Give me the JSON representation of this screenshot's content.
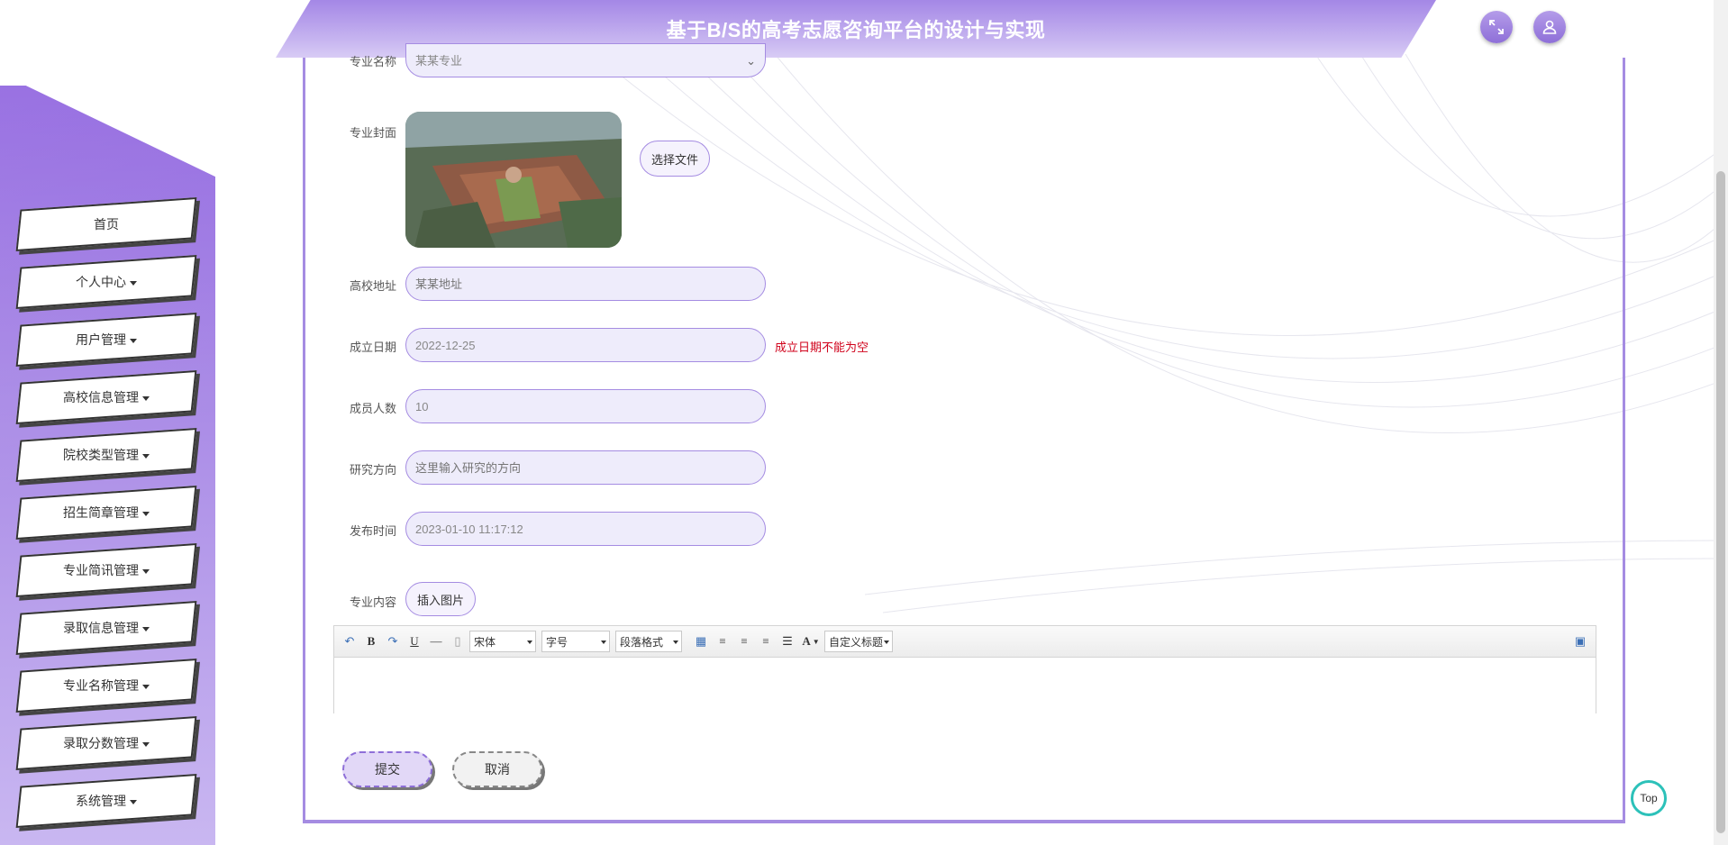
{
  "header": {
    "title": "基于B/S的高考志愿咨询平台的设计与实现",
    "fullscreen_icon": "expand-icon",
    "user_icon": "user-icon"
  },
  "sidebar": {
    "items": [
      {
        "label": "首页",
        "has_caret": false
      },
      {
        "label": "个人中心",
        "has_caret": true
      },
      {
        "label": "用户管理",
        "has_caret": true
      },
      {
        "label": "高校信息管理",
        "has_caret": true
      },
      {
        "label": "院校类型管理",
        "has_caret": true
      },
      {
        "label": "招生简章管理",
        "has_caret": true
      },
      {
        "label": "专业简讯管理",
        "has_caret": true
      },
      {
        "label": "录取信息管理",
        "has_caret": true
      },
      {
        "label": "专业名称管理",
        "has_caret": true
      },
      {
        "label": "录取分数管理",
        "has_caret": true
      },
      {
        "label": "系统管理",
        "has_caret": true
      }
    ]
  },
  "form": {
    "major_name": {
      "label": "专业名称",
      "value": "某某专业"
    },
    "cover": {
      "label": "专业封面",
      "button": "选择文件"
    },
    "address": {
      "label": "高校地址",
      "placeholder": "某某地址"
    },
    "founded": {
      "label": "成立日期",
      "value": "2022-12-25",
      "error": "成立日期不能为空"
    },
    "members": {
      "label": "成员人数",
      "value": "10"
    },
    "research": {
      "label": "研究方向",
      "placeholder": "这里输入研究的方向"
    },
    "publish_time": {
      "label": "发布时间",
      "value": "2023-01-10 11:17:12"
    },
    "content": {
      "label": "专业内容",
      "insert_image": "插入图片"
    }
  },
  "editor": {
    "font_family": "宋体",
    "font_size": "字号",
    "paragraph": "段落格式",
    "custom_title": "自定义标题",
    "bold": "B",
    "underline": "U",
    "font_color": "A"
  },
  "actions": {
    "submit": "提交",
    "cancel": "取消"
  },
  "back_to_top": "Top",
  "colors": {
    "accent": "#a58ce2",
    "sidebar": "#8e62df",
    "error": "#d0021b",
    "top_ring": "#2cc1b9"
  }
}
